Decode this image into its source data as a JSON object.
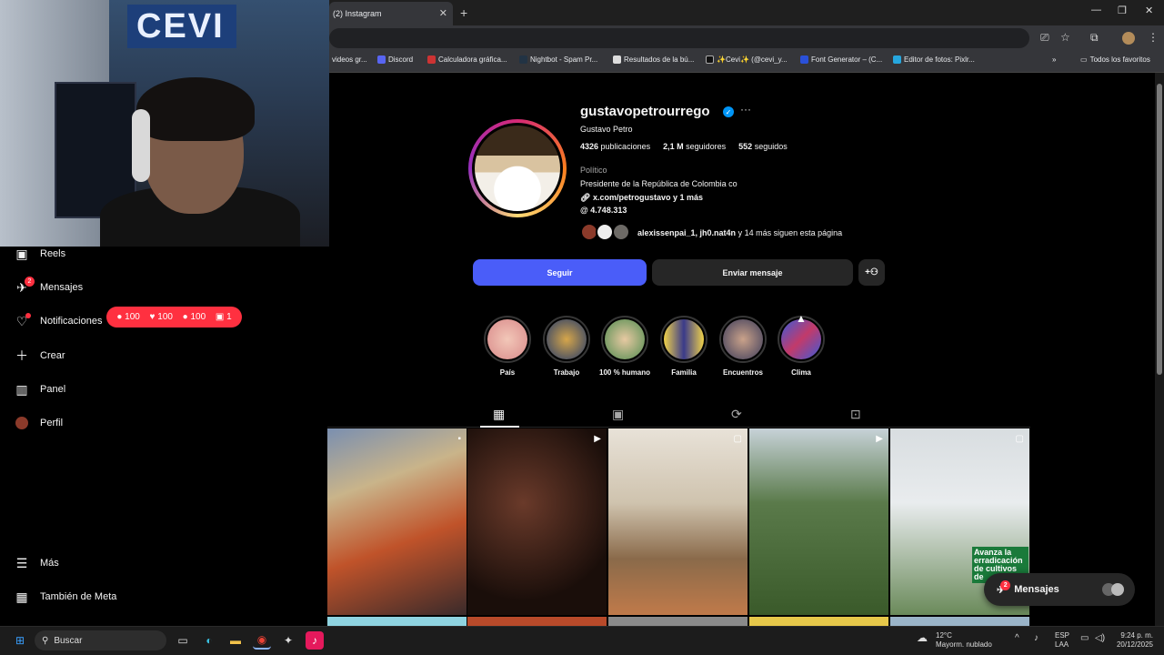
{
  "browser": {
    "tab_title": "(2) Instagram",
    "bookmarks": [
      "videos gr...",
      "Discord",
      "Calculadora gráfica...",
      "Nightbot - Spam Pr...",
      "Resultados de la bú...",
      "✨Cevi✨ (@cevi_y...",
      "Font Generator – (C...",
      "Editor de fotos: Pixlr...",
      "Todos los favoritos"
    ],
    "webcam_sign": "CEVI"
  },
  "sidebar": {
    "items": [
      {
        "label": "Reels",
        "icon": "reels-icon"
      },
      {
        "label": "Mensajes",
        "icon": "messenger-icon",
        "badge": "2"
      },
      {
        "label": "Notificaciones",
        "icon": "heart-icon"
      },
      {
        "label": "Crear",
        "icon": "plus-icon"
      },
      {
        "label": "Panel",
        "icon": "chart-icon"
      },
      {
        "label": "Perfil",
        "icon": "avatar-icon"
      }
    ],
    "bottom": [
      {
        "label": "Más",
        "icon": "menu-icon"
      },
      {
        "label": "También de Meta",
        "icon": "meta-icon"
      }
    ],
    "notif_pill": {
      "comments": "100",
      "likes": "100",
      "follows": "100",
      "tags": "1"
    }
  },
  "profile": {
    "username": "gustavopetrourrego",
    "full_name": "Gustavo Petro",
    "posts": "4326",
    "posts_label": "publicaciones",
    "followers": "2,1 M",
    "followers_label": "seguidores",
    "following": "552",
    "following_label": "seguidos",
    "category": "Político",
    "bio": "Presidente de la República de Colombia co",
    "link": "x.com/petrogustavo y 1 más",
    "threads": "4.748.313",
    "followed_by_names": "alexissenpai_1, jh0.nat4n",
    "followed_by_rest": "y 14 más siguen esta página"
  },
  "actions": {
    "follow": "Seguir",
    "message": "Enviar mensaje"
  },
  "highlights": [
    "País",
    "Trabajo",
    "100 % humano",
    "Familia",
    "Encuentros",
    "Clima"
  ],
  "posts_overlay_text": "Avanza la erradicación de cultivos de",
  "chat": {
    "label": "Mensajes",
    "badge": "2"
  },
  "taskbar": {
    "search": "Buscar",
    "weather_temp": "12°C",
    "weather_desc": "Mayorm. nublado",
    "lang1": "ESP",
    "lang2": "LAA",
    "time": "9:24 p. m.",
    "date": "20/12/2025"
  }
}
